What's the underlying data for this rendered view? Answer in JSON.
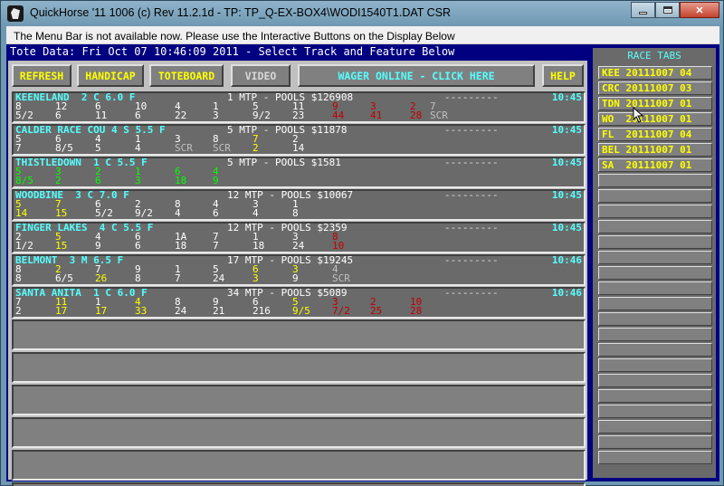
{
  "window": {
    "title": "QuickHorse '11 1006 (c) Rev 11.2.1d - TP: TP_Q-EX-BOX4\\WODI1540T1.DAT CSR",
    "controls": [
      "minimize",
      "maximize",
      "close"
    ]
  },
  "menubar_message": "The Menu Bar is not available now.  Please use the Interactive Buttons on the Display Below",
  "tote_header": "Tote Data: Fri Oct 07 10:46:09 2011 - Select Track and Feature Below",
  "buttons": {
    "refresh": "REFRESH",
    "handicap": "HANDICAP",
    "toteboard": "TOTEBOARD",
    "video": "VIDEO",
    "wager": "WAGER ONLINE - CLICK HERE",
    "help": "HELP"
  },
  "races": [
    {
      "track": "KEENELAND  2 C 6.0 F",
      "mtp": "1 MTP - POOLS $126908",
      "dashes": "---------",
      "time": "10:45",
      "row2": [
        [
          "8",
          "w"
        ],
        [
          "12",
          "w"
        ],
        [
          "6",
          "w"
        ],
        [
          "10",
          "w"
        ],
        [
          "4",
          "w"
        ],
        [
          "1",
          "w"
        ],
        [
          "5",
          "w"
        ],
        [
          "11",
          "w"
        ],
        [
          "9",
          "r"
        ],
        [
          "3",
          "r"
        ],
        [
          "2",
          "r"
        ],
        [
          "7",
          "s"
        ]
      ],
      "row3": [
        [
          "5/2",
          "w"
        ],
        [
          "6",
          "w"
        ],
        [
          "11",
          "w"
        ],
        [
          "6",
          "w"
        ],
        [
          "22",
          "w"
        ],
        [
          "3",
          "w"
        ],
        [
          "9/2",
          "w"
        ],
        [
          "23",
          "w"
        ],
        [
          "44",
          "r"
        ],
        [
          "41",
          "r"
        ],
        [
          "28",
          "r"
        ],
        [
          "SCR",
          "s"
        ]
      ]
    },
    {
      "track": "CALDER RACE COU 4 S 5.5 F",
      "mtp": "5 MTP - POOLS $11878",
      "dashes": "---------",
      "time": "10:45",
      "row2": [
        [
          "5",
          "w"
        ],
        [
          "6",
          "w"
        ],
        [
          "4",
          "w"
        ],
        [
          "1",
          "w"
        ],
        [
          "3",
          "w"
        ],
        [
          "8",
          "w"
        ],
        [
          "7",
          "y"
        ],
        [
          "2",
          "w"
        ]
      ],
      "row3": [
        [
          "7",
          "w"
        ],
        [
          "8/5",
          "w"
        ],
        [
          "5",
          "w"
        ],
        [
          "4",
          "w"
        ],
        [
          "SCR",
          "s"
        ],
        [
          "SCR",
          "s"
        ],
        [
          "2",
          "y"
        ],
        [
          "14",
          "w"
        ]
      ]
    },
    {
      "track": "THISTLEDOWN  1 C 5.5 F",
      "mtp": "5 MTP - POOLS $1581",
      "dashes": "---------",
      "time": "10:45",
      "row2": [
        [
          "5",
          "g"
        ],
        [
          "3",
          "g"
        ],
        [
          "2",
          "g"
        ],
        [
          "1",
          "g"
        ],
        [
          "6",
          "g"
        ],
        [
          "4",
          "g"
        ]
      ],
      "row3": [
        [
          "8/5",
          "g"
        ],
        [
          "2",
          "g"
        ],
        [
          "6",
          "g"
        ],
        [
          "3",
          "g"
        ],
        [
          "18",
          "g"
        ],
        [
          "9",
          "g"
        ]
      ]
    },
    {
      "track": "WOODBINE  3 C 7.0 F",
      "mtp": "12 MTP - POOLS $10067",
      "dashes": "---------",
      "time": "10:45",
      "row2": [
        [
          "5",
          "y"
        ],
        [
          "7",
          "y"
        ],
        [
          "6",
          "w"
        ],
        [
          "2",
          "w"
        ],
        [
          "8",
          "w"
        ],
        [
          "4",
          "w"
        ],
        [
          "3",
          "w"
        ],
        [
          "1",
          "w"
        ]
      ],
      "row3": [
        [
          "14",
          "y"
        ],
        [
          "15",
          "y"
        ],
        [
          "5/2",
          "w"
        ],
        [
          "9/2",
          "w"
        ],
        [
          "4",
          "w"
        ],
        [
          "6",
          "w"
        ],
        [
          "4",
          "w"
        ],
        [
          "8",
          "w"
        ]
      ]
    },
    {
      "track": "FINGER LAKES  4 C 5.5 F",
      "mtp": "12 MTP - POOLS $2359",
      "dashes": "---------",
      "time": "10:45",
      "row2": [
        [
          "2",
          "w"
        ],
        [
          "5",
          "y"
        ],
        [
          "4",
          "w"
        ],
        [
          "6",
          "w"
        ],
        [
          "1A",
          "w"
        ],
        [
          "7",
          "w"
        ],
        [
          "1",
          "w"
        ],
        [
          "3",
          "w"
        ],
        [
          "8",
          "r"
        ]
      ],
      "row3": [
        [
          "1/2",
          "w"
        ],
        [
          "15",
          "y"
        ],
        [
          "9",
          "w"
        ],
        [
          "6",
          "w"
        ],
        [
          "18",
          "w"
        ],
        [
          "7",
          "w"
        ],
        [
          "18",
          "w"
        ],
        [
          "24",
          "w"
        ],
        [
          "10",
          "r"
        ]
      ]
    },
    {
      "track": "BELMONT  3 M 6.5 F",
      "mtp": "17 MTP - POOLS $19245",
      "dashes": "---------",
      "time": "10:46",
      "row2": [
        [
          "8",
          "w"
        ],
        [
          "2",
          "y"
        ],
        [
          "7",
          "w"
        ],
        [
          "9",
          "w"
        ],
        [
          "1",
          "w"
        ],
        [
          "5",
          "w"
        ],
        [
          "6",
          "y"
        ],
        [
          "3",
          "y"
        ],
        [
          "4",
          "s"
        ]
      ],
      "row3": [
        [
          "8",
          "w"
        ],
        [
          "6/5",
          "w"
        ],
        [
          "26",
          "y"
        ],
        [
          "8",
          "w"
        ],
        [
          "7",
          "w"
        ],
        [
          "24",
          "w"
        ],
        [
          "3",
          "y"
        ],
        [
          "9",
          "w"
        ],
        [
          "SCR",
          "s"
        ]
      ]
    },
    {
      "track": "SANTA ANITA  1 C 6.0 F",
      "mtp": "34 MTP - POOLS $5089",
      "dashes": "---------",
      "time": "10:46",
      "row2": [
        [
          "7",
          "w"
        ],
        [
          "11",
          "y"
        ],
        [
          "1",
          "w"
        ],
        [
          "4",
          "y"
        ],
        [
          "8",
          "w"
        ],
        [
          "9",
          "w"
        ],
        [
          "6",
          "w"
        ],
        [
          "5",
          "y"
        ],
        [
          "3",
          "r"
        ],
        [
          "2",
          "r"
        ],
        [
          "10",
          "r"
        ]
      ],
      "row3": [
        [
          "2",
          "w"
        ],
        [
          "17",
          "y"
        ],
        [
          "17",
          "y"
        ],
        [
          "33",
          "y"
        ],
        [
          "24",
          "w"
        ],
        [
          "21",
          "w"
        ],
        [
          "216",
          "w"
        ],
        [
          "9/5",
          "y"
        ],
        [
          "7/2",
          "r"
        ],
        [
          "25",
          "r"
        ],
        [
          "28",
          "r"
        ]
      ]
    }
  ],
  "race_tabs": {
    "title": "RACE TABS",
    "tabs": [
      "KEE 20111007 04",
      "CRC 20111007 03",
      "TDN 20111007 01",
      "WO  20111007 01",
      "FL  20111007 04",
      "BEL 20111007 01",
      "SA  20111007 01"
    ]
  },
  "colors": {
    "title_cyan": "#55ffff",
    "button_yellow": "#ffff00",
    "green_odds": "#00ff00",
    "red_odds": "#c00000",
    "panel_navy": "#000080"
  }
}
